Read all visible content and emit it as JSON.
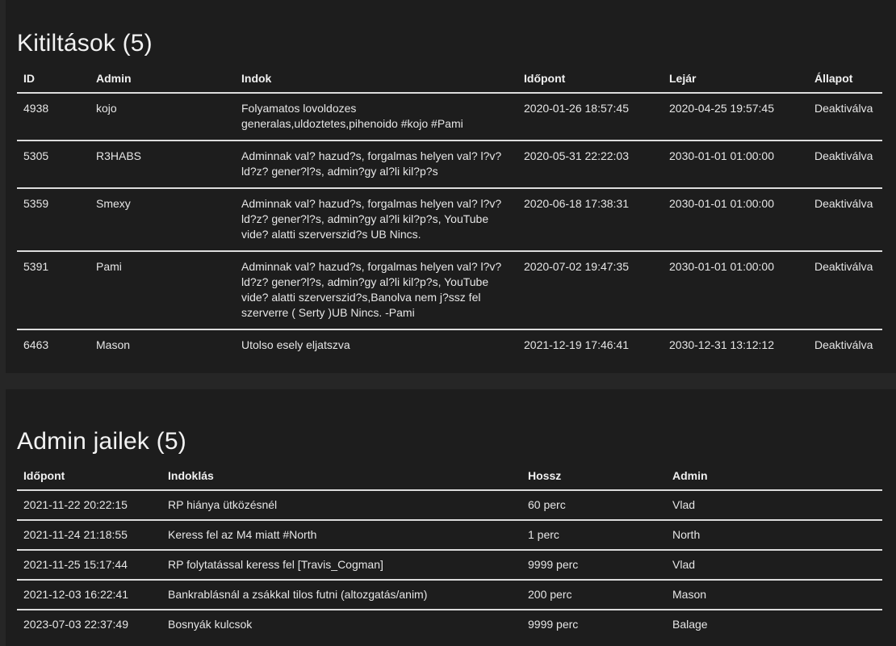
{
  "bans": {
    "title": "Kitiltások (5)",
    "headers": {
      "id": "ID",
      "admin": "Admin",
      "reason": "Indok",
      "time": "Időpont",
      "expires": "Lejár",
      "status": "Állapot"
    },
    "rows": [
      {
        "id": "4938",
        "admin": "kojo",
        "reason": "Folyamatos lovoldozes generalas,uldoztetes,pihenoido #kojo #Pami",
        "time": "2020-01-26 18:57:45",
        "expires": "2020-04-25 19:57:45",
        "status": "Deaktiválva"
      },
      {
        "id": "5305",
        "admin": "R3HABS",
        "reason": "Adminnak val? hazud?s, forgalmas helyen val? l?v?ld?z? gener?l?s, admin?gy al?li kil?p?s",
        "time": "2020-05-31 22:22:03",
        "expires": "2030-01-01 01:00:00",
        "status": "Deaktiválva"
      },
      {
        "id": "5359",
        "admin": "Smexy",
        "reason": "Adminnak val? hazud?s, forgalmas helyen val? l?v?ld?z? gener?l?s, admin?gy al?li kil?p?s, YouTube vide? alatti szerverszid?s UB Nincs.",
        "time": "2020-06-18 17:38:31",
        "expires": "2030-01-01 01:00:00",
        "status": "Deaktiválva"
      },
      {
        "id": "5391",
        "admin": "Pami",
        "reason": "Adminnak val? hazud?s, forgalmas helyen val? l?v?ld?z? gener?l?s, admin?gy al?li kil?p?s, YouTube vide? alatti szerverszid?s,Banolva nem j?ssz fel szerverre ( Serty )UB Nincs. -Pami",
        "time": "2020-07-02 19:47:35",
        "expires": "2030-01-01 01:00:00",
        "status": "Deaktiválva"
      },
      {
        "id": "6463",
        "admin": "Mason",
        "reason": "Utolso esely eljatszva",
        "time": "2021-12-19 17:46:41",
        "expires": "2030-12-31 13:12:12",
        "status": "Deaktiválva"
      }
    ]
  },
  "jails": {
    "title": "Admin jailek (5)",
    "headers": {
      "time": "Időpont",
      "reason": "Indoklás",
      "length": "Hossz",
      "admin": "Admin"
    },
    "rows": [
      {
        "time": "2021-11-22 20:22:15",
        "reason": "RP hiánya ütközésnél",
        "length": "60 perc",
        "admin": "Vlad"
      },
      {
        "time": "2021-11-24 21:18:55",
        "reason": "Keress fel az M4 miatt #North",
        "length": "1 perc",
        "admin": "North"
      },
      {
        "time": "2021-11-25 15:17:44",
        "reason": "RP folytatással keress fel [Travis_Cogman]",
        "length": "9999 perc",
        "admin": "Vlad"
      },
      {
        "time": "2021-12-03 16:22:41",
        "reason": "Bankrablásnál a zsákkal tilos futni (altozgatás/anim)",
        "length": "200 perc",
        "admin": "Mason"
      },
      {
        "time": "2023-07-03 22:37:49",
        "reason": "Bosnyák kulcsok",
        "length": "9999 perc",
        "admin": "Balage"
      }
    ]
  },
  "colors": {
    "status_deactivated": "#8fd16a",
    "panel_bg": "#1d1d1d",
    "page_bg": "#262626"
  }
}
